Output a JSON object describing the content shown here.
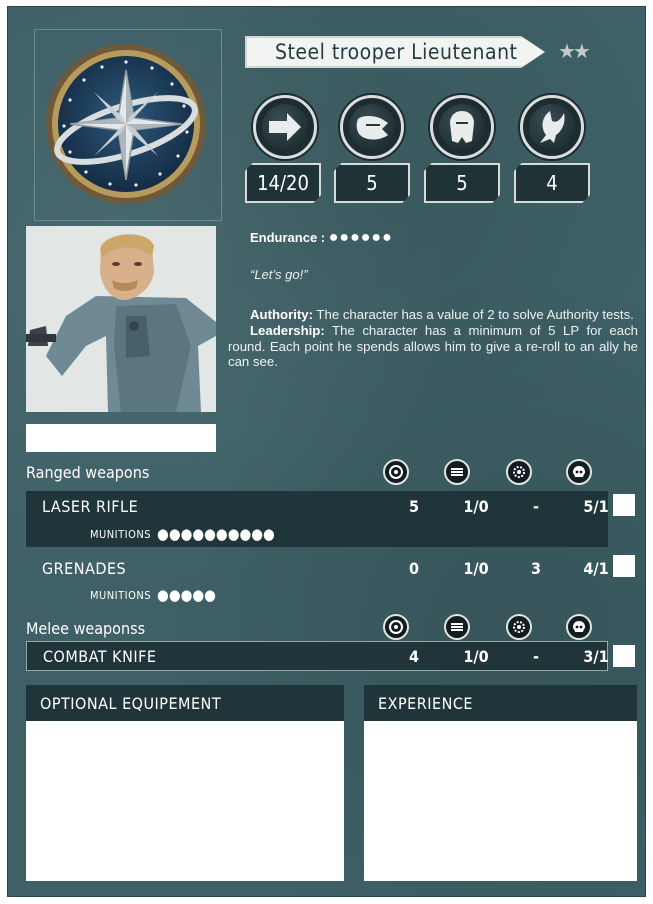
{
  "character": {
    "name": "Steel trooper Lieutenant",
    "rank_stars": "★★",
    "stats": [
      {
        "icon": "movement-arrow-icon",
        "value": "14/20"
      },
      {
        "icon": "combat-fist-icon",
        "value": "5"
      },
      {
        "icon": "defense-armor-icon",
        "value": "5"
      },
      {
        "icon": "willpower-claw-icon",
        "value": "4"
      }
    ],
    "endurance_label": "Endurance :",
    "endurance_dots": "●●●●●●",
    "quote": "“Let’s go!”",
    "abilities": [
      {
        "name": "Authority:",
        "text": " The character has a value of 2 to solve Authority tests."
      },
      {
        "name": "Leadership:",
        "text": " The character has a minimum of 5 LP for each round. Each point he spends allows him to give a re-roll to an ally he can see."
      }
    ]
  },
  "ranged": {
    "label": "Ranged weapons",
    "column_icons": [
      "target-icon",
      "rate-of-fire-icon",
      "blast-icon",
      "skull-icon"
    ],
    "weapons": [
      {
        "name": "LASER RIFLE",
        "values": [
          "5",
          "1/0",
          "-",
          "5/1"
        ],
        "munitions_label": "MUNITIONS",
        "munitions_dots": "●●●●●●●●●●"
      },
      {
        "name": "GRENADES",
        "values": [
          "0",
          "1/0",
          "3",
          "4/1"
        ],
        "munitions_label": "MUNITIONS",
        "munitions_dots": "●●●●●"
      }
    ]
  },
  "melee": {
    "label": "Melee weaponss",
    "column_icons": [
      "target-icon",
      "rate-of-fire-icon",
      "blast-icon",
      "skull-icon"
    ],
    "weapons": [
      {
        "name": "COMBAT KNIFE",
        "values": [
          "4",
          "1/0",
          "-",
          "3/1"
        ]
      }
    ]
  },
  "panels": {
    "equipment": "OPTIONAL EQUIPEMENT",
    "experience": "EXPERIENCE"
  },
  "colors": {
    "card_bg": "#3e6066",
    "band": "#1f353a",
    "text": "#ffffff"
  }
}
